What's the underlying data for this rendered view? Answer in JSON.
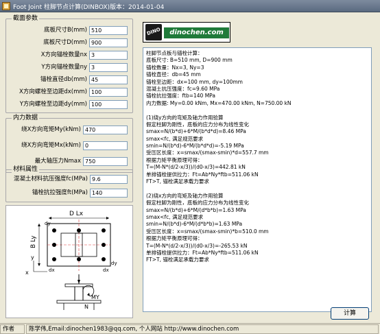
{
  "window": {
    "title": "Foot Joint 柱脚节点计算(DINBOX)版本：2014-01-04"
  },
  "section_params": {
    "title": "截面参数",
    "fields": [
      {
        "label": "底板尺寸B(mm)",
        "value": "510"
      },
      {
        "label": "底板尺寸D(mm)",
        "value": "900"
      },
      {
        "label": "X方向锚栓数量nx",
        "value": "3"
      },
      {
        "label": "Y方向锚栓数量ny",
        "value": "3"
      },
      {
        "label": "锚栓直径db(mm)",
        "value": "45"
      },
      {
        "label": "X方向螺栓至边距dx(mm)",
        "value": "100"
      },
      {
        "label": "Y方向螺栓至边距dy(mm)",
        "value": "100"
      }
    ]
  },
  "internal_force": {
    "title": "内力数据",
    "fields": [
      {
        "label": "绕X方向弯矩My(kNm)",
        "value": "470"
      },
      {
        "label": "绕X方向弯矩Mx(kNm)",
        "value": "0"
      },
      {
        "label": "最大轴压力Nmax",
        "value": "750"
      }
    ]
  },
  "material": {
    "title": "材料属性",
    "fields": [
      {
        "label": "混凝土材料抗压强度fc(MPa)",
        "value": "9.6"
      },
      {
        "label": "锚栓抗拉强度ft(MPa)",
        "value": "140"
      }
    ]
  },
  "logo": {
    "badge": "DINO",
    "site": "dinochen.com"
  },
  "diagram": {
    "label_dlx": "D  Lx",
    "label_bly": "B  Ly",
    "label_x": "x",
    "label_y": "y",
    "label_dx_left": "dx",
    "label_dx_right": "dx",
    "label_dy_top": "dy",
    "label_dy_bottom": "dy",
    "label_my": "MY",
    "label_n": "N"
  },
  "result": {
    "lines": [
      "柱脚节点板与锚栓计算：",
      "底板尺寸: B=510 mm, D=900 mm",
      "锚栓数量：Nx=3, Ny=3",
      "锚栓直径：db=45 mm",
      "锚栓至边距：dx=100 mm, dy=100mm",
      "混凝土抗压强度：fc=9.60 MPa",
      "锚栓抗拉强度：ftb=140 MPa",
      "内力数据: My=0.00 kNm, Mx=470.00 kNm, N=750.00 kN",
      "",
      "(1)绕y方向的弯矩及轴力作用验算",
      "假定柱脚为刚性，底板的应力分布为线性变化",
      "smax=N/(b*d)+6*M/(b*d*d)=8.46 MPa",
      "smax<fc, 满足规范要求",
      "smin=N/(b*d)-6*M/(b*d*d)=-5.19 MPa",
      "受压区长度：x=smax/(smax-smin)*d=557.7 mm",
      "根据力矩平衡原理可得：",
      "T=(M-N*(d/2-x/3))/(d0-x/3)=442.81 kN",
      "单排锚栓提供拉力：Ft=Ab*Ny*ftb=511.06 kN",
      "FT>T, 锚栓满足承载力要求",
      "",
      "(2)绕x方向的弯矩及轴力作用验算",
      "假定柱脚为刚性，底板的应力分布为线性变化",
      "smax=N/(b*d)+6*M/(d*b*b)=1.63 MPa",
      "smax<fc, 满足规范要求",
      "smin=N/(b*d)-6*M/(d*b*b)=1.63 MPa",
      "受压区长度：x=smax/(smax-smin)*b=510.0 mm",
      "根据力矩平衡原理可得：",
      "T=(M-N*(d/2-x/3))/(d0-x/3)=-265.53 kN",
      "单排锚栓提供拉力：Ft=Ab*Ny*ftb=511.06 kN",
      "FT>T, 锚栓满足承载力要求"
    ]
  },
  "buttons": {
    "calculate": "计算"
  },
  "statusbar": {
    "author_label": "作者",
    "author_info": "陈学伟,Email:dinochen1983@qq.com, 个人网站 http://www.dinochen.com"
  }
}
